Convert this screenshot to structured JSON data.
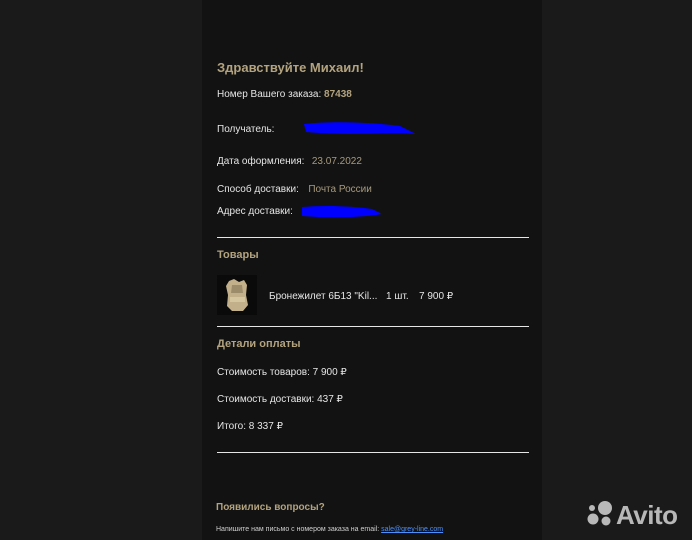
{
  "email": {
    "greeting": "Здравствуйте Михаил!",
    "order_number_label": "Номер Вашего заказа:",
    "order_number": "87438",
    "recipient_label": "Получатель:",
    "date_label": "Дата оформления:",
    "date_value": "23.07.2022",
    "delivery_method_label": "Способ доставки:",
    "delivery_method_value": "Почта России",
    "address_label": "Адрес доставки:",
    "redaction_color": "#0000ff"
  },
  "goods": {
    "title": "Товары",
    "items": [
      {
        "name": "Бронежилет 6Б13 \"Kil...",
        "qty": "1 шт.",
        "price": "7 900 ₽"
      }
    ]
  },
  "payment": {
    "title": "Детали оплаты",
    "goods_cost": "Стоимость товаров: 7 900 ₽",
    "delivery_cost": "Стоимость доставки: 437 ₽",
    "total": "Итого: 8 337 ₽"
  },
  "footer": {
    "question": "Появились вопросы?",
    "write_text": "Напишите нам письмо с номером заказа на email:",
    "email_link": "sale@grey-line.com"
  },
  "watermark": {
    "brand": "Avito",
    "icon": "avito-dots-icon"
  },
  "colors": {
    "accent": "#b3a37f",
    "background": "#1a1a1a",
    "panel": "#121212",
    "link": "#4a90ff"
  }
}
